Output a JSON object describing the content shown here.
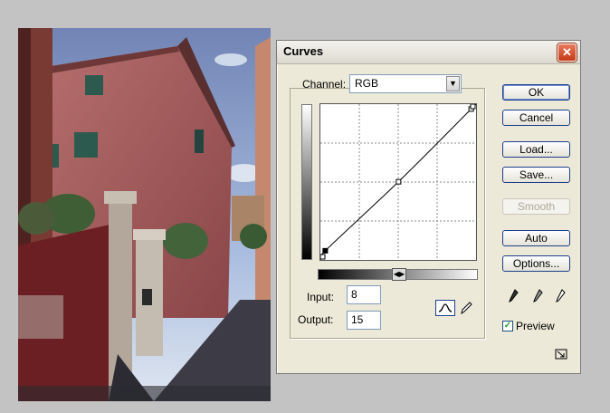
{
  "dialog": {
    "title": "Curves",
    "close_glyph": "✕"
  },
  "channel": {
    "label": "Channel:",
    "selected": "RGB"
  },
  "curve": {
    "input_label": "Input:",
    "output_label": "Output:",
    "input_value": "8",
    "output_value": "15",
    "points": [
      [
        8,
        15
      ],
      [
        128,
        128
      ],
      [
        247,
        247
      ]
    ]
  },
  "buttons": {
    "ok": "OK",
    "cancel": "Cancel",
    "load": "Load...",
    "save": "Save...",
    "smooth": "Smooth",
    "auto": "Auto",
    "options": "Options..."
  },
  "preview": {
    "label": "Preview",
    "checked": true
  },
  "icons": {
    "curve_tool": "curve-tool-icon",
    "pencil_tool": "pencil-icon",
    "black_eyedropper": "eyedropper-icon",
    "gray_eyedropper": "eyedropper-icon",
    "white_eyedropper": "eyedropper-icon",
    "resize": "resize-icon"
  }
}
